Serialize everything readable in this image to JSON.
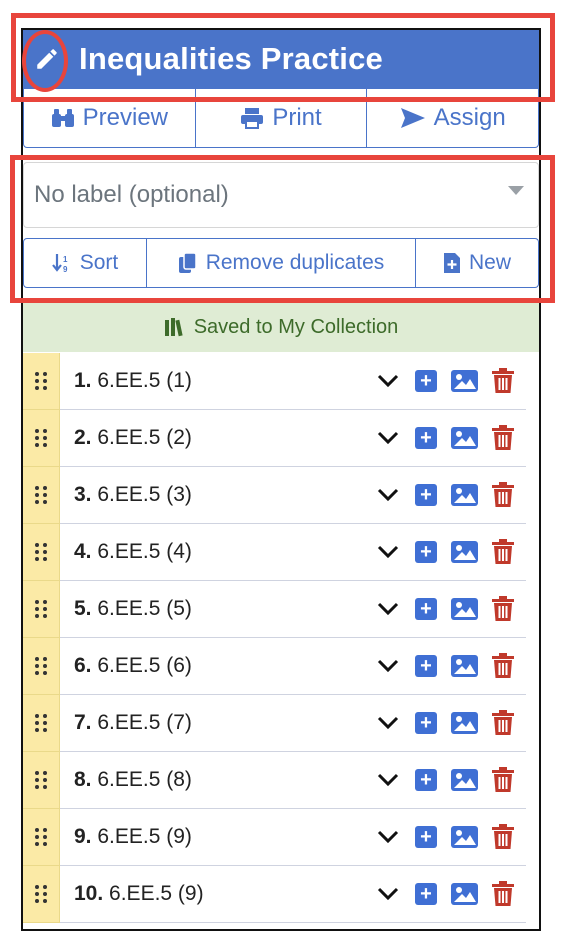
{
  "header": {
    "title": "Inequalities Practice",
    "edit_icon": "pencil-icon",
    "bg_color": "#4a74c9"
  },
  "actions": {
    "preview": "Preview",
    "print": "Print",
    "assign": "Assign"
  },
  "label_select": {
    "placeholder": "No label (optional)"
  },
  "tools": {
    "sort": "Sort",
    "remove_duplicates": "Remove duplicates",
    "new": "New"
  },
  "saved_banner": {
    "text": "Saved to My Collection"
  },
  "items": [
    {
      "num": "1.",
      "label": "6.EE.5 (1)"
    },
    {
      "num": "2.",
      "label": "6.EE.5 (2)"
    },
    {
      "num": "3.",
      "label": "6.EE.5 (3)"
    },
    {
      "num": "4.",
      "label": "6.EE.5 (4)"
    },
    {
      "num": "5.",
      "label": "6.EE.5 (5)"
    },
    {
      "num": "6.",
      "label": "6.EE.5 (6)"
    },
    {
      "num": "7.",
      "label": "6.EE.5 (7)"
    },
    {
      "num": "8.",
      "label": "6.EE.5 (8)"
    },
    {
      "num": "9.",
      "label": "6.EE.5 (9)"
    },
    {
      "num": "10.",
      "label": "6.EE.5 (9)"
    }
  ],
  "colors": {
    "accent": "#4a74c9",
    "saved_bg": "#dfecd4",
    "handle_bg": "#fbeaa6",
    "trash": "#c0392b",
    "annotation": "#e8453c"
  }
}
